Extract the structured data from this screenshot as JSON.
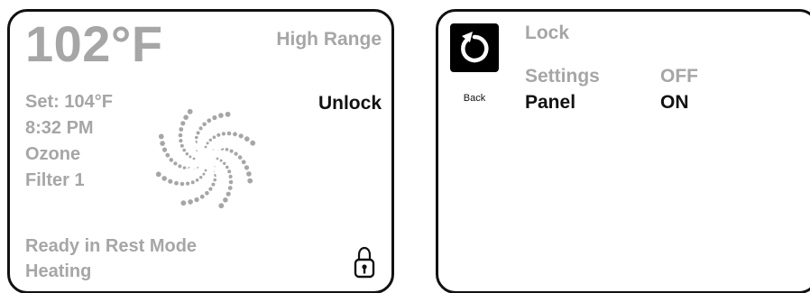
{
  "status_screen": {
    "temperature": "102°F",
    "range_label": "High Range",
    "unlock_label": "Unlock",
    "set_temp": "Set: 104°F",
    "time": "8:32 PM",
    "ozone": "Ozone",
    "filter": "Filter 1",
    "ready_mode": "Ready in Rest Mode",
    "heating": "Heating",
    "spinner_icon": "circulation-spinner-icon",
    "lock_icon": "padlock-icon"
  },
  "lock_screen": {
    "back_label": "Back",
    "back_icon": "back-arrow-icon",
    "title": "Lock",
    "rows": [
      {
        "label": "Settings",
        "value": "OFF",
        "state": "inactive"
      },
      {
        "label": "Panel",
        "value": "ON",
        "state": "active"
      }
    ]
  },
  "colors": {
    "panel_border": "#111111",
    "inactive_text": "#a6a6a6",
    "active_text": "#111111",
    "background": "#ffffff"
  }
}
